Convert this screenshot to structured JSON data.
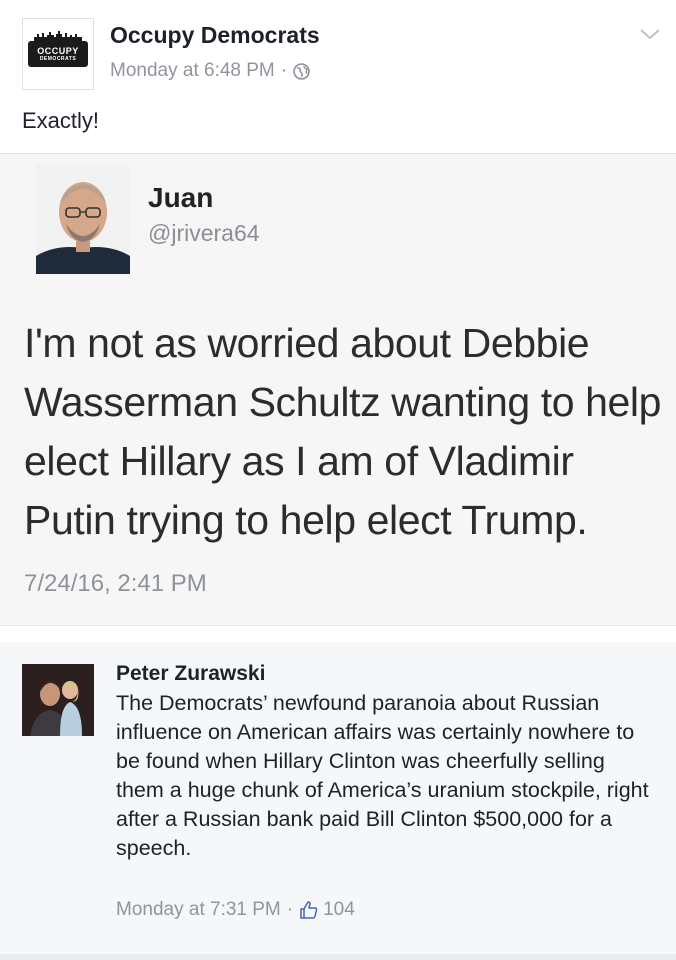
{
  "post": {
    "page_name": "Occupy Democrats",
    "timestamp": "Monday at 6:48 PM",
    "separator": "·",
    "privacy_icon": "globe-icon",
    "text": "Exactly!",
    "logo_text_line1": "OCCUPY",
    "logo_text_line2": "DEMOCRATS"
  },
  "tweet": {
    "name": "Juan",
    "handle": "@jrivera64",
    "body": "I'm not as worried about Debbie Wasserman Schultz wanting to help elect Hillary as I am of Vladimir Putin trying to help elect Trump.",
    "time": "7/24/16, 2:41 PM"
  },
  "comment": {
    "author": "Peter Zurawski",
    "text": "The Democrats’ newfound paranoia about Russian influence on American affairs was certainly nowhere to be found when Hillary Clinton was cheerfully selling them a huge chunk of America’s uranium stockpile, right after a Russian bank paid Bill Clinton $500,000 for a speech.",
    "timestamp": "Monday at 7:31 PM",
    "separator": "·",
    "like_count": "104"
  },
  "colors": {
    "meta_gray": "#90949c",
    "text_dark": "#1d2129",
    "tweet_bg": "#f6f6f6"
  }
}
